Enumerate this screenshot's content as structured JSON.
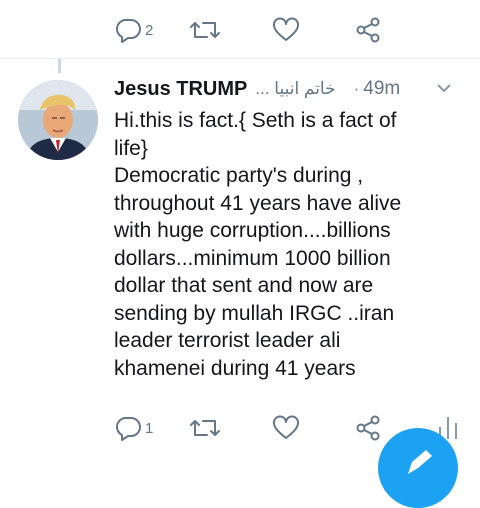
{
  "top_actions": {
    "reply_count": "2",
    "retweet_count": "",
    "like_count": ""
  },
  "tweet": {
    "author_name": "Jesus TRUMP",
    "author_handle": "خاتم انبیا ...",
    "separator": "·",
    "time": "49m",
    "text_lines": [
      "Hi.this is fact.{ Seth is a fact of",
      "life}",
      "Democratic party's during ,",
      "throughout  41 years have alive",
      "with huge corruption....billions",
      "dollars...minimum 1000 billion",
      "dollar that sent and now are",
      "sending by mullah  IRGC ..iran",
      "leader terrorist leader ali",
      "khamenei during 41 years"
    ]
  },
  "bottom_actions": {
    "reply_count": "1",
    "retweet_count": "",
    "like_count": ""
  },
  "colors": {
    "icon_gray": "#657786",
    "divider": "#e6ecf0",
    "accent_blue": "#1da1f2",
    "text": "#14171a"
  },
  "icons": {
    "reply": "reply-icon",
    "retweet": "retweet-icon",
    "like": "heart-icon",
    "share": "share-icon",
    "more": "chevron-down-icon",
    "analytics": "analytics-icon",
    "compose": "compose-icon"
  }
}
